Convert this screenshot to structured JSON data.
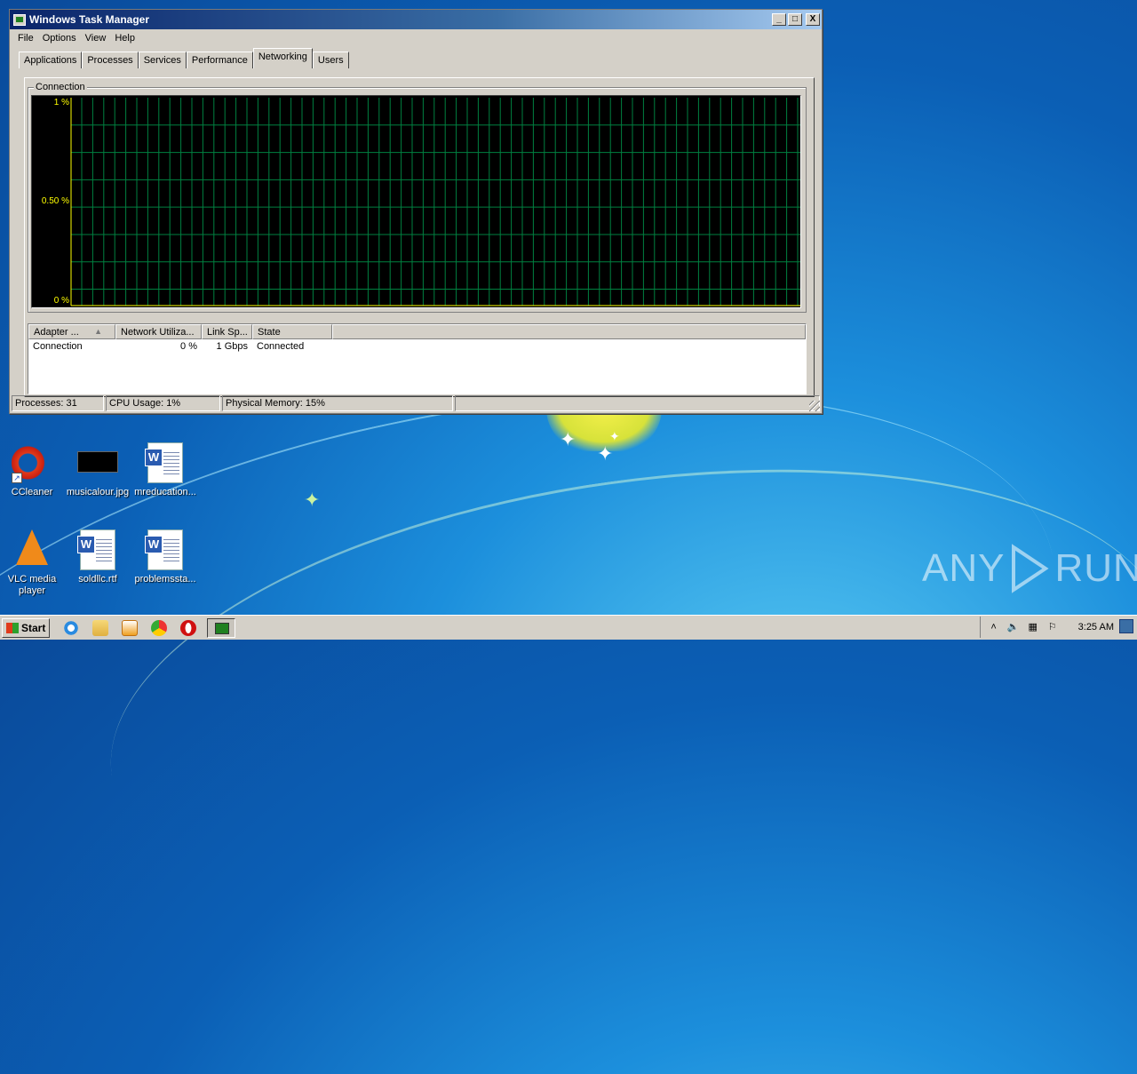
{
  "window": {
    "title": "Windows Task Manager",
    "controls": {
      "minimize": "_",
      "maximize": "□",
      "close": "X"
    }
  },
  "menu": [
    "File",
    "Options",
    "View",
    "Help"
  ],
  "tabs": [
    {
      "label": "Applications",
      "active": false
    },
    {
      "label": "Processes",
      "active": false
    },
    {
      "label": "Services",
      "active": false
    },
    {
      "label": "Performance",
      "active": false
    },
    {
      "label": "Networking",
      "active": true
    },
    {
      "label": "Users",
      "active": false
    }
  ],
  "networking": {
    "group_label": "Connection",
    "graph": {
      "y_labels": [
        "1 %",
        "0.50 %",
        "0 %"
      ],
      "utilization_percent": 0,
      "grid_color": "#008040",
      "background": "#000000",
      "axis_color": "#ffff00"
    },
    "list": {
      "columns": [
        "Adapter ...",
        "Network Utiliza...",
        "Link Sp...",
        "State"
      ],
      "rows": [
        [
          "Connection",
          "0 %",
          "1 Gbps",
          "Connected"
        ]
      ]
    }
  },
  "status_bar": {
    "processes": "Processes: 31",
    "cpu": "CPU Usage: 1%",
    "memory": "Physical Memory: 15%"
  },
  "desktop_icons": [
    {
      "label": "CCleaner",
      "icon": "ccleaner-icon"
    },
    {
      "label": "musicalour.jpg",
      "icon": "image-file-icon"
    },
    {
      "label": "mreducation...",
      "icon": "word-document-icon"
    },
    {
      "label": "VLC media player",
      "icon": "vlc-icon"
    },
    {
      "label": "soldllc.rtf",
      "icon": "word-document-icon"
    },
    {
      "label": "problemssta...",
      "icon": "word-document-icon"
    }
  ],
  "taskbar": {
    "start_label": "Start",
    "clock": "3:25 AM",
    "quick_launch": [
      "internet-explorer-icon",
      "folder-icon",
      "media-player-icon",
      "chrome-icon",
      "opera-icon"
    ]
  },
  "watermark": {
    "left": "ANY",
    "right": "RUN"
  }
}
